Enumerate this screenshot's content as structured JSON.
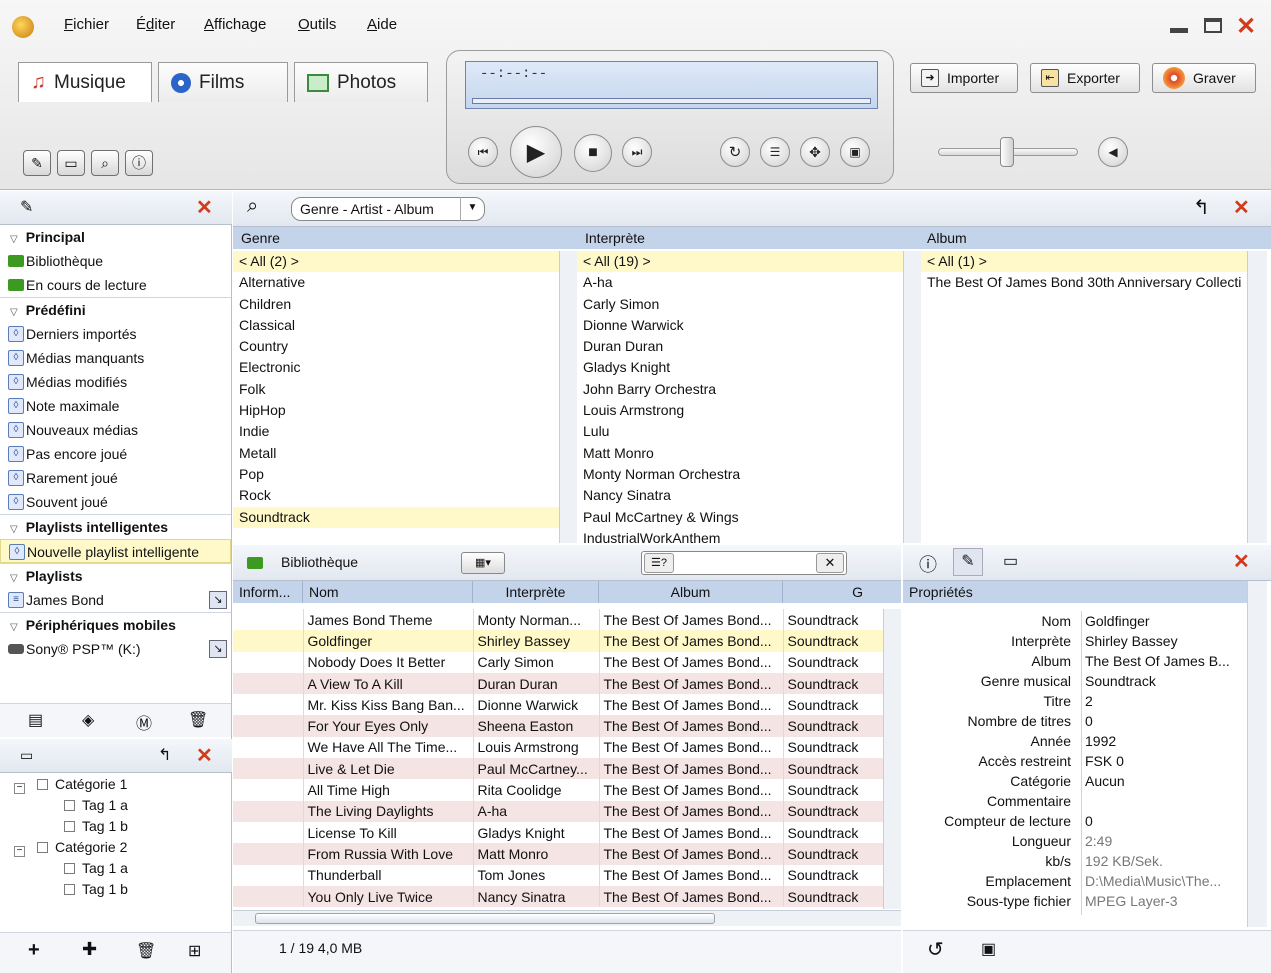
{
  "menu": [
    "Fichier",
    "Éditer",
    "Affichage",
    "Outils",
    "Aide"
  ],
  "menu_underline": [
    "F",
    "d",
    "A",
    "O",
    "A"
  ],
  "tabs": [
    {
      "label": "Musique"
    },
    {
      "label": "Films"
    },
    {
      "label": "Photos"
    }
  ],
  "lcd_time": "--:--:--",
  "right_buttons": [
    "Importer",
    "Exporter",
    "Graver"
  ],
  "search": {
    "mode": "Genre - Artist - Album"
  },
  "browser": {
    "genre_header": "Genre",
    "artist_header": "Interprète",
    "album_header": "Album",
    "genres": [
      "< All (2) >",
      "Alternative",
      "Children",
      "Classical",
      "Country",
      "Electronic",
      "Folk",
      "HipHop",
      "Indie",
      "Metall",
      "Pop",
      "Rock",
      "Soundtrack"
    ],
    "artists": [
      "< All (19) >",
      "A-ha",
      "Carly Simon",
      "Dionne Warwick",
      "Duran Duran",
      "Gladys Knight",
      "John Barry Orchestra",
      "Louis Armstrong",
      "Lulu",
      "Matt Monro",
      "Monty Norman Orchestra",
      "Nancy Sinatra",
      "Paul McCartney & Wings",
      "IndustrialWorkAnthem"
    ],
    "albums": [
      "< All (1) >",
      "The Best Of James Bond 30th Anniversary Collecti"
    ]
  },
  "sidebar": {
    "principal": {
      "title": "Principal",
      "items": [
        "Bibliothèque",
        "En cours de lecture"
      ]
    },
    "predefini": {
      "title": "Prédéfini",
      "items": [
        "Derniers importés",
        "Médias manquants",
        "Médias modifiés",
        "Note maximale",
        "Nouveaux médias",
        "Pas encore joué",
        "Rarement joué",
        "Souvent joué"
      ]
    },
    "smart": {
      "title": "Playlists intelligentes",
      "items": [
        "Nouvelle playlist intelligente"
      ]
    },
    "playlists": {
      "title": "Playlists",
      "items": [
        "James Bond"
      ]
    },
    "mobile": {
      "title": "Périphériques mobiles",
      "items": [
        "Sony® PSP™ (K:)"
      ]
    }
  },
  "tags": {
    "items": [
      {
        "label": "Catégorie 1",
        "level": 0
      },
      {
        "label": "Tag 1 a",
        "level": 1
      },
      {
        "label": "Tag 1 b",
        "level": 1
      },
      {
        "label": "Catégorie 2",
        "level": 0
      },
      {
        "label": "Tag 1 a",
        "level": 1
      },
      {
        "label": "Tag 1 b",
        "level": 1
      }
    ]
  },
  "library": {
    "title": "Bibliothèque",
    "columns": [
      "Inform...",
      "Nom",
      "Interprète",
      "Album",
      "G"
    ],
    "rows": [
      [
        "",
        "James Bond Theme",
        "Monty Norman...",
        "The Best Of James Bond...",
        "Soundtrack"
      ],
      [
        "",
        "Goldfinger",
        "Shirley Bassey",
        "The Best Of James Bond...",
        "Soundtrack"
      ],
      [
        "",
        "Nobody Does It Better",
        "Carly Simon",
        "The Best Of James Bond...",
        "Soundtrack"
      ],
      [
        "",
        "A View To A Kill",
        "Duran Duran",
        "The Best Of James Bond...",
        "Soundtrack"
      ],
      [
        "",
        "Mr. Kiss Kiss Bang Ban...",
        "Dionne Warwick",
        "The Best Of James Bond...",
        "Soundtrack"
      ],
      [
        "",
        "For Your Eyes Only",
        "Sheena Easton",
        "The Best Of James Bond...",
        "Soundtrack"
      ],
      [
        "",
        "We Have All The Time...",
        "Louis Armstrong",
        "The Best Of James Bond...",
        "Soundtrack"
      ],
      [
        "",
        "Live & Let Die",
        "Paul McCartney...",
        "The Best Of James Bond...",
        "Soundtrack"
      ],
      [
        "",
        "All Time High",
        "Rita Coolidge",
        "The Best Of James Bond...",
        "Soundtrack"
      ],
      [
        "",
        "The Living Daylights",
        "A-ha",
        "The Best Of James Bond...",
        "Soundtrack"
      ],
      [
        "",
        "License To Kill",
        "Gladys Knight",
        "The Best Of James Bond...",
        "Soundtrack"
      ],
      [
        "",
        "From Russia With Love",
        "Matt Monro",
        "The Best Of James Bond...",
        "Soundtrack"
      ],
      [
        "",
        "Thunderball",
        "Tom Jones",
        "The Best Of James Bond...",
        "Soundtrack"
      ],
      [
        "",
        "You Only Live Twice",
        "Nancy Sinatra",
        "The Best Of James Bond...",
        "Soundtrack"
      ]
    ],
    "selected_row": 1,
    "status": "1 / 19  4,0 MB"
  },
  "properties": {
    "title": "Propriétés",
    "rows": [
      {
        "label": "Nom",
        "value": "Goldfinger"
      },
      {
        "label": "Interprète",
        "value": "Shirley Bassey"
      },
      {
        "label": "Album",
        "value": "The Best Of James B..."
      },
      {
        "label": "Genre musical",
        "value": "Soundtrack"
      },
      {
        "label": "Titre",
        "value": "2"
      },
      {
        "label": "Nombre de titres",
        "value": "0"
      },
      {
        "label": "Année",
        "value": "1992"
      },
      {
        "label": "Accès restreint",
        "value": "FSK 0"
      },
      {
        "label": "Catégorie",
        "value": "Aucun"
      },
      {
        "label": "Commentaire",
        "value": ""
      },
      {
        "label": "Compteur de lecture",
        "value": "0"
      },
      {
        "label": "Longueur",
        "value": "2:49",
        "grey": true
      },
      {
        "label": "kb/s",
        "value": "192 KB/Sek.",
        "grey": true
      },
      {
        "label": "Emplacement",
        "value": "D:\\Media\\Music\\The...",
        "grey": true
      },
      {
        "label": "Sous-type fichier",
        "value": "MPEG Layer-3",
        "grey": true
      }
    ]
  },
  "colors": {
    "accent": "#c3d4ea",
    "selection": "#fff9c9",
    "alt_row": "#f4e5e4",
    "close": "#d23a1a"
  }
}
